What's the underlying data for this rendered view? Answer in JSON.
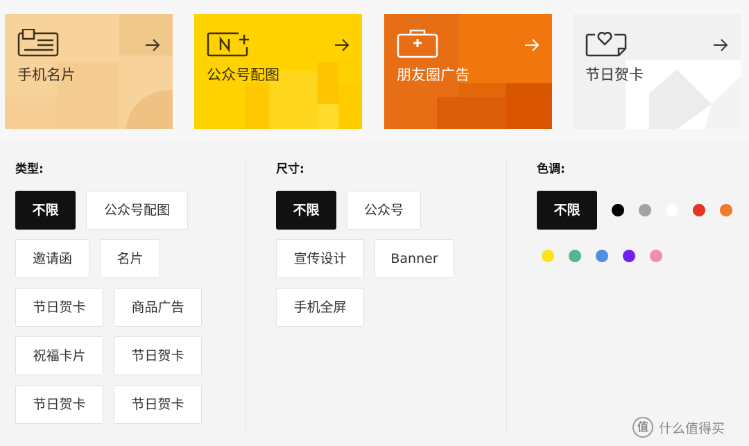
{
  "cards": [
    {
      "label": "手机名片",
      "icon": "business-card-icon",
      "bg": "#f8d29b"
    },
    {
      "label": "公众号配图",
      "icon": "new-image-icon",
      "bg": "#ffd200"
    },
    {
      "label": "朋友圈广告",
      "icon": "medical-box-icon",
      "bg": "#e76e14"
    },
    {
      "label": "节日贺卡",
      "icon": "heart-card-icon",
      "bg": "#f1f1f1"
    }
  ],
  "filters": {
    "type": {
      "title": "类型:",
      "options": [
        "不限",
        "公众号配图",
        "邀请函",
        "名片",
        "节日贺卡",
        "商品广告",
        "祝福卡片",
        "节日贺卡",
        "节日贺卡",
        "节日贺卡"
      ],
      "selected": 0
    },
    "size": {
      "title": "尺寸:",
      "options": [
        "不限",
        "公众号",
        "宣传设计",
        "Banner",
        "手机全屏"
      ],
      "selected": 0
    },
    "tone": {
      "title": "色调:",
      "all_label": "不限",
      "colors": [
        "#000000",
        "#a3a3a3",
        "#ffffff",
        "#e8332a",
        "#ef7a2e",
        "#ffe21a",
        "#52b989",
        "#4e8fe2",
        "#7320f0",
        "#f08fa8"
      ]
    }
  },
  "watermark": {
    "glyph": "值",
    "text": "什么值得买"
  }
}
